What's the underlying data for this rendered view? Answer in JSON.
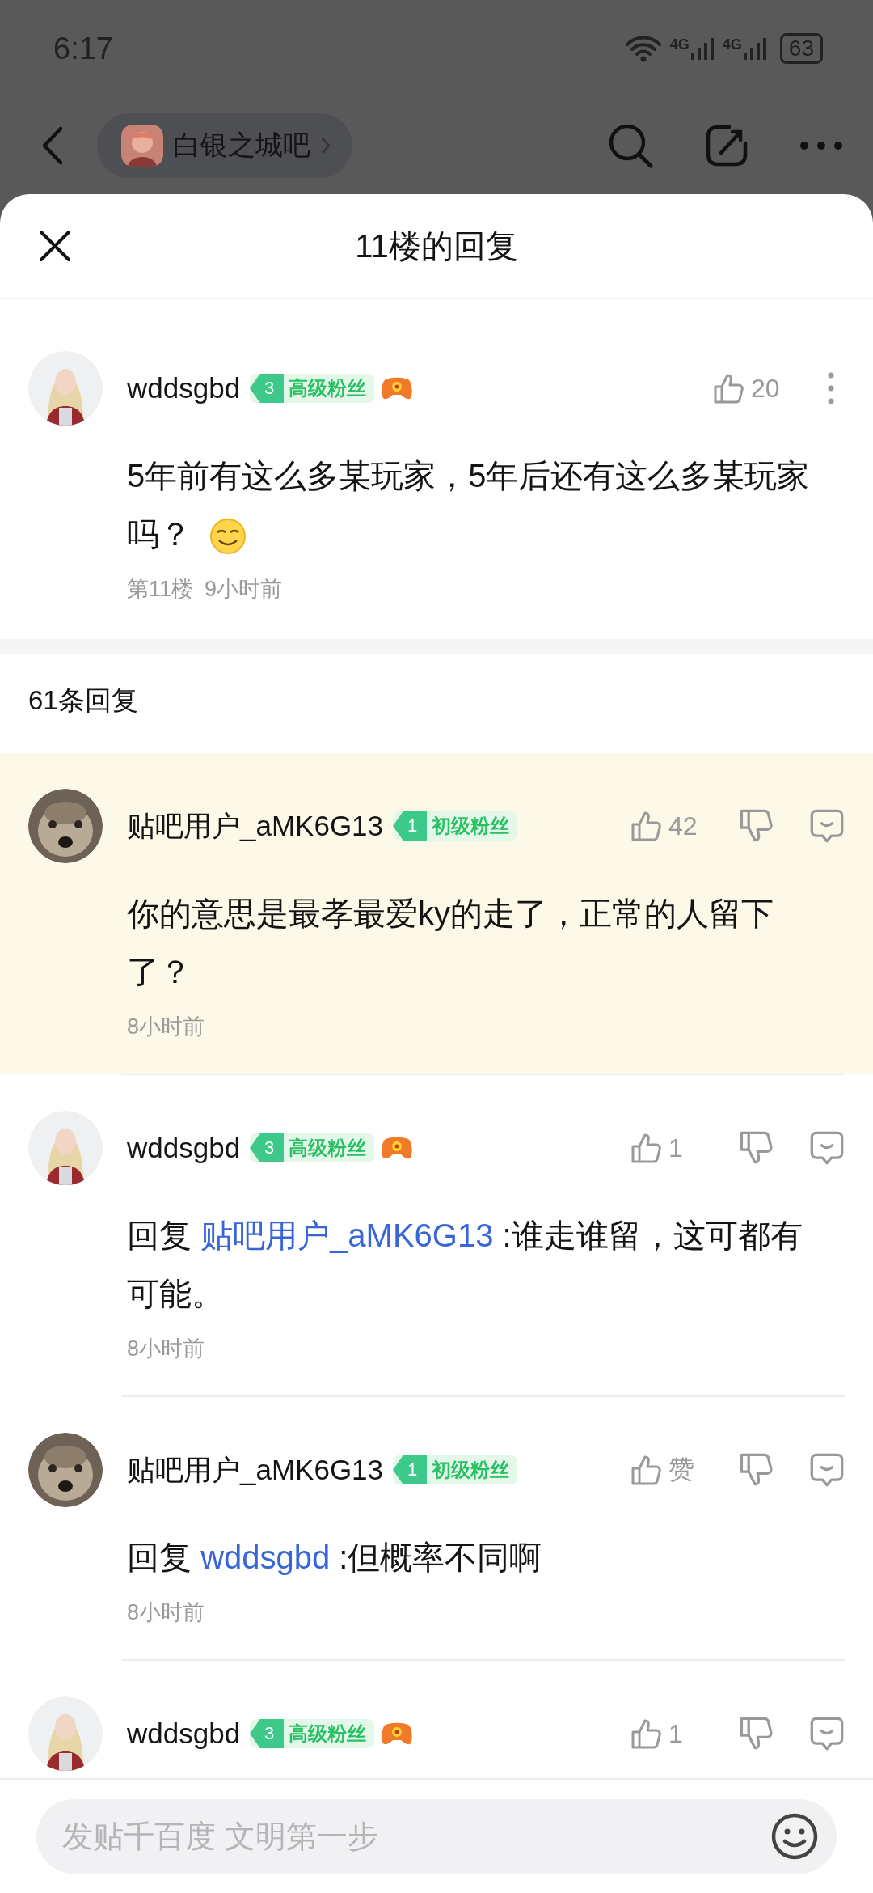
{
  "status_bar": {
    "time": "6:17",
    "battery": "63",
    "network": [
      "4G",
      "4G"
    ]
  },
  "nav": {
    "forum": "白银之城吧"
  },
  "sheet": {
    "title": "11楼的回复"
  },
  "post": {
    "user": "wddsgbd",
    "badge": {
      "level": "3",
      "label": "高级粉丝"
    },
    "game_badge": true,
    "likes": "20",
    "content": "5年前有这么多某玩家，5年后还有这么多某玩家吗？",
    "has_emoji": true,
    "floor": "第11楼",
    "time": "9小时前"
  },
  "reply_count": "61条回复",
  "replies": [
    {
      "user": "贴吧用户_aMK6G13",
      "badge": {
        "level": "1",
        "label": "初级粉丝"
      },
      "game_badge": false,
      "likes": "42",
      "highlighted": true,
      "kind": "plain",
      "content": "你的意思是最孝最爱ky的走了，正常的人留下了？",
      "time": "8小时前"
    },
    {
      "user": "wddsgbd",
      "badge": {
        "level": "3",
        "label": "高级粉丝"
      },
      "game_badge": true,
      "likes": "1",
      "highlighted": false,
      "kind": "reply_to",
      "target": "贴吧用户_aMK6G13",
      "content": ":谁走谁留，这可都有可能。",
      "time": "8小时前"
    },
    {
      "user": "贴吧用户_aMK6G13",
      "badge": {
        "level": "1",
        "label": "初级粉丝"
      },
      "game_badge": false,
      "likes": "赞",
      "highlighted": false,
      "kind": "reply_to",
      "target": "wddsgbd",
      "content": ":但概率不同啊",
      "time": "8小时前"
    },
    {
      "user": "wddsgbd",
      "badge": {
        "level": "3",
        "label": "高级粉丝"
      },
      "game_badge": true,
      "likes": "1",
      "highlighted": false,
      "kind": "cut"
    }
  ],
  "reply_prefix": [
    "回复",
    "回复"
  ],
  "input": {
    "placeholder": "发贴千百度 文明第一步"
  }
}
